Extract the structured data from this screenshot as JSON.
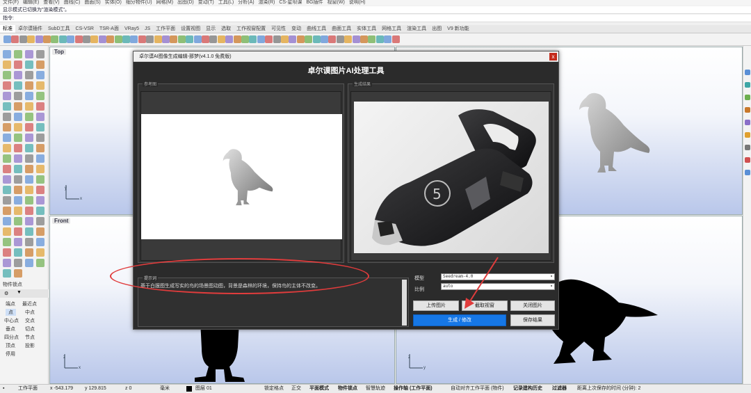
{
  "menu": [
    "文件(F)",
    "编辑(E)",
    "查看(V)",
    "曲线(C)",
    "曲面(S)",
    "实体(O)",
    "细分物件(U)",
    "网格(M)",
    "出图(D)",
    "变动(T)",
    "工具(L)",
    "分析(A)",
    "渲染(R)",
    "CS-星坝课",
    "BG插件",
    "视窗(W)",
    "说明(H)"
  ],
  "command": {
    "history": "显示模式已切换为\"渲染模式\"。",
    "prompt_label": "指令:"
  },
  "tabs": [
    "标准",
    "卓尔谟插件",
    "SubD工具",
    "CS-VSR",
    "TSR-A面",
    "VRay5",
    "JS",
    "工作平面",
    "设置视图",
    "显示",
    "选取",
    "工作视窗配置",
    "可见性",
    "变动",
    "曲线工具",
    "曲面工具",
    "实体工具",
    "网格工具",
    "渲染工具",
    "出图",
    "V9 新功能"
  ],
  "viewports": {
    "top_label": "Top",
    "front_label": "Front"
  },
  "osnap": {
    "title": "物件锁点",
    "items": [
      "端点",
      "最近点",
      "点",
      "中点",
      "中心点",
      "交点",
      "垂点",
      "切点",
      "四分点",
      "节点",
      "顶点",
      "投影",
      "停用"
    ]
  },
  "dialog": {
    "titlebar": "卓尔谟AI图像生成编辑-那梦(v4.1.0 免费版)",
    "close_glyph": "x",
    "heading": "卓尔谟图片AI处理工具",
    "ref_legend": "参考图",
    "result_legend": "生成结果",
    "prompt_legend": "提示词",
    "prompt_text": "基于白膜图生成写实的鸟的场景图动图，背景是森林的环境，保持鸟的主体不改变。",
    "model_label": "模型",
    "model_value": "Seedream-4.0",
    "ratio_label": "比例",
    "ratio_value": "auto",
    "btn_upload": "上传图片",
    "btn_capture": "截取视窗",
    "btn_close_img": "关闭图片",
    "btn_generate": "生成 / 修改",
    "btn_save": "保存结果"
  },
  "status": {
    "cplane": "工作平面",
    "x": "x -543.179",
    "y": "y 129.815",
    "z": "z 0",
    "unit": "毫米",
    "layer": "图层 01",
    "grid_snap": "锁定格点",
    "ortho": "正交",
    "planar": "平面模式",
    "osnap": "物件锁点",
    "smarttrack": "智慧轨迹",
    "gumball": "操作轴 (工作平面)",
    "auto_cplane": "自动对齐工作平面 (物件)",
    "history": "记录建构历史",
    "filter": "过滤器",
    "autosave": "距离上次保存的时间 (分钟): 2"
  },
  "colors": {
    "accent": "#1677e6",
    "annotation": "#e03c3c",
    "dialog_bg": "#2b2b2b"
  }
}
